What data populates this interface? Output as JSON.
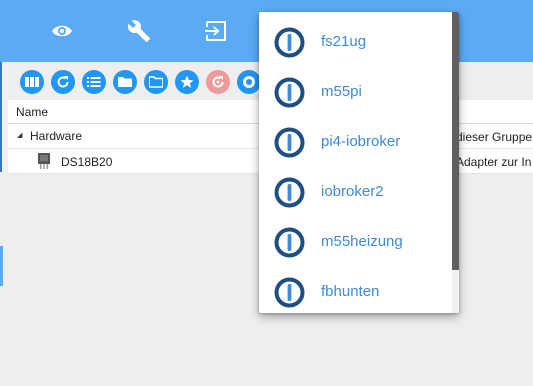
{
  "appbar": {
    "buttons": [
      {
        "icon": "eye-icon"
      },
      {
        "icon": "wrench-icon"
      },
      {
        "icon": "login-icon"
      }
    ]
  },
  "toolbar": {
    "buttons": [
      {
        "icon": "columns-icon"
      },
      {
        "icon": "refresh-icon"
      },
      {
        "icon": "list-icon"
      },
      {
        "icon": "folder-icon"
      },
      {
        "icon": "folder-open-icon"
      },
      {
        "icon": "star-icon"
      },
      {
        "icon": "reload-disabled-icon"
      },
      {
        "icon": "github-icon"
      }
    ]
  },
  "table": {
    "header": {
      "name": "Name"
    },
    "group": {
      "label": "Hardware",
      "description_fragment": "dieser Gruppe"
    },
    "device": {
      "label": "DS18B20",
      "description_fragment": "Adapter zur In"
    }
  },
  "host_menu": {
    "items": [
      {
        "label": "fs21ug"
      },
      {
        "label": "m55pi"
      },
      {
        "label": "pi4-iobroker"
      },
      {
        "label": "iobroker2"
      },
      {
        "label": "m55heizung"
      },
      {
        "label": "fbhunten"
      }
    ]
  },
  "colors": {
    "appbar": "#5aaaf4",
    "toolbar_button": "#2196f3",
    "disabled_button": "#ef9a9a",
    "menu_text": "#3d8bd6",
    "logo_ring": "#1f4e80"
  }
}
